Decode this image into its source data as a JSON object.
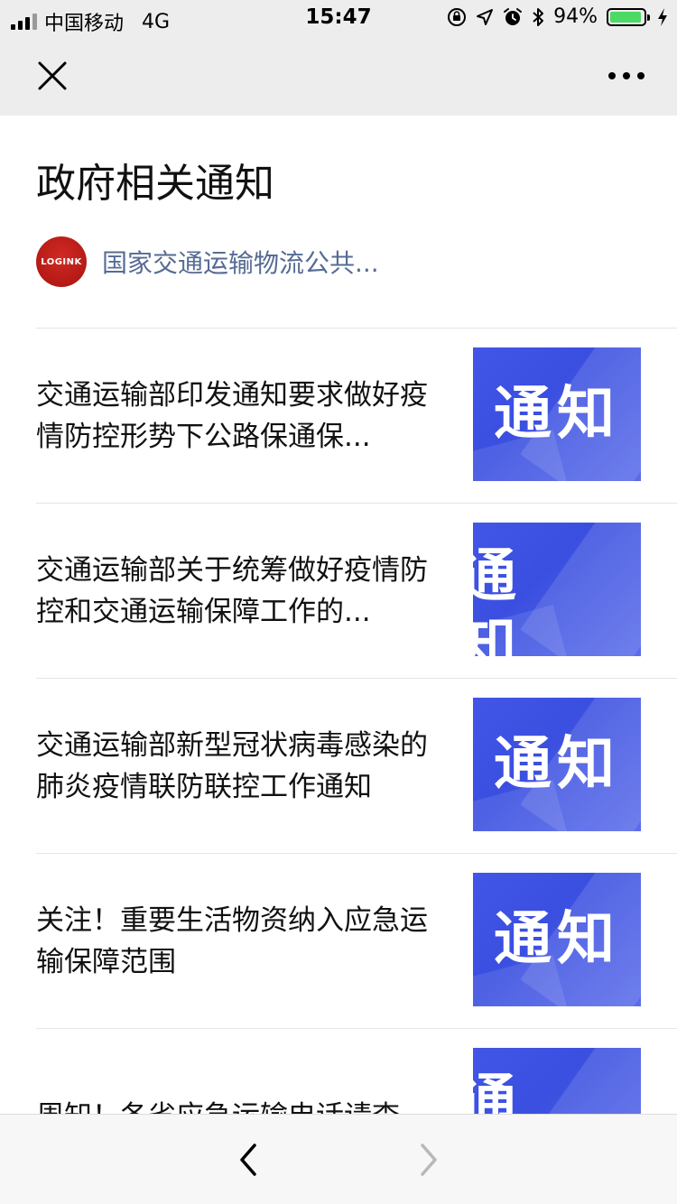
{
  "status_bar": {
    "carrier": "中国移动",
    "network": "4G",
    "time": "15:47",
    "battery_percent": "94%",
    "battery_level": 0.94,
    "icons": [
      "signal-icon",
      "orientation-lock-icon",
      "location-icon",
      "alarm-icon",
      "bluetooth-icon",
      "battery-icon",
      "charging-icon"
    ]
  },
  "nav": {
    "close_icon": "close-icon",
    "more_icon": "more-icon"
  },
  "page": {
    "title": "政府相关通知",
    "account": {
      "avatar_text": "LOGINK",
      "name": "国家交通运输物流公共..."
    }
  },
  "articles": [
    {
      "title": "交通运输部印发通知要求做好疫情防控形势下公路保通保...",
      "thumb_text": "通知"
    },
    {
      "title": "交通运输部关于统筹做好疫情防控和交通运输保障工作的...",
      "thumb_text": "通知"
    },
    {
      "title": "交通运输部新型冠状病毒感染的肺炎疫情联防联控工作通知",
      "thumb_text": "通知"
    },
    {
      "title": "关注！重要生活物资纳入应急运输保障范围",
      "thumb_text": "通知"
    },
    {
      "title": "周知！各省应急运输电话请查",
      "thumb_text": "通知"
    }
  ],
  "toolbar": {
    "back_icon": "chevron-left-icon",
    "forward_icon": "chevron-right-icon"
  },
  "colors": {
    "bar_bg": "#ededed",
    "link": "#576b95",
    "thumb_blue": "#4255e6",
    "battery_green": "#4cd964",
    "avatar_red": "#c0211c"
  }
}
